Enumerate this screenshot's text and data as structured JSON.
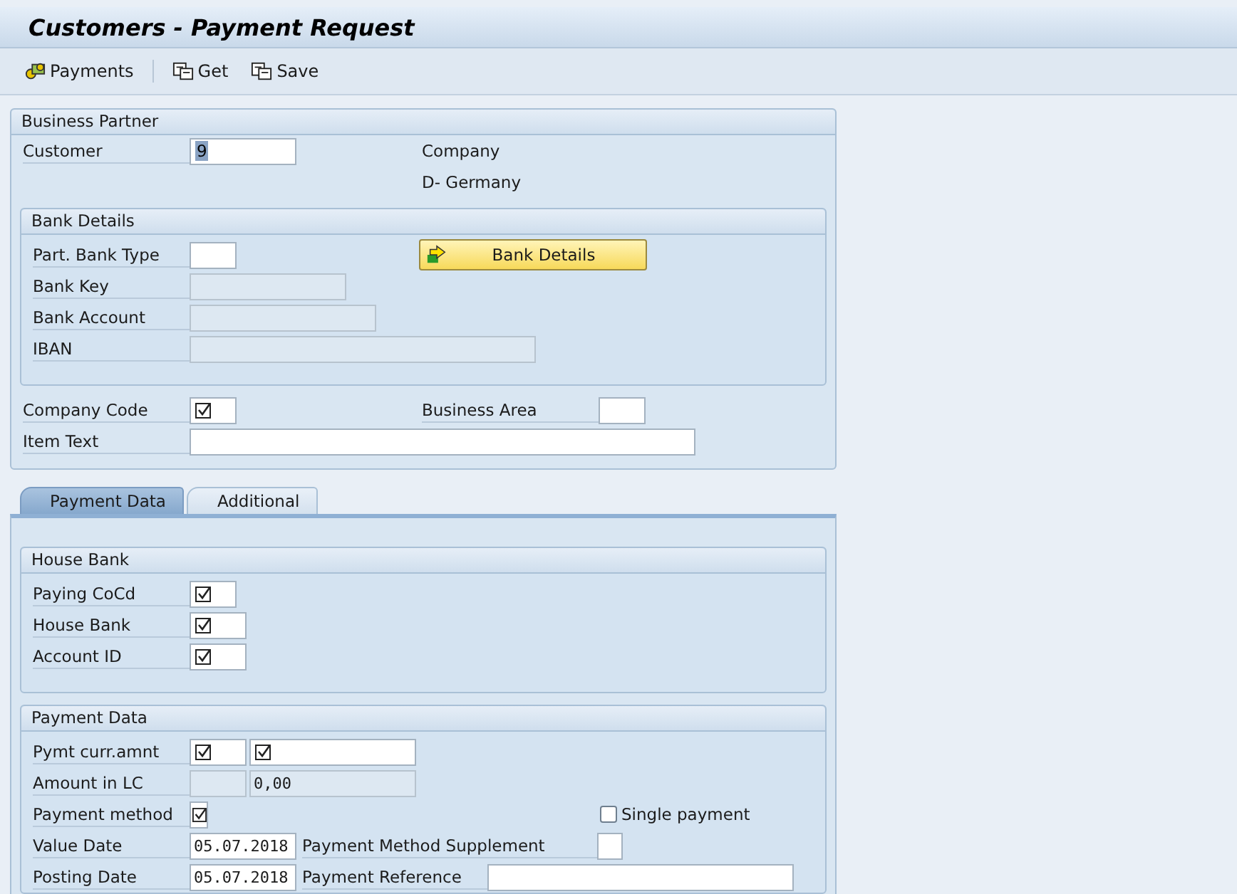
{
  "window": {
    "title": "Customers - Payment Request"
  },
  "toolbar": [
    {
      "label": "Payments",
      "kind": "payments"
    },
    {
      "label": "Get",
      "kind": "copy"
    },
    {
      "label": "Save",
      "kind": "copy"
    }
  ],
  "business_partner": {
    "title": "Business Partner",
    "customer": {
      "label": "Customer",
      "value": "9"
    },
    "company": "Company",
    "country": "D- Germany"
  },
  "bank_details": {
    "title": "Bank Details",
    "button": "Bank Details",
    "fields": [
      {
        "label": "Part. Bank Type",
        "kind": "input"
      },
      {
        "label": "Bank Key",
        "kind": "readonly"
      },
      {
        "label": "Bank Account",
        "kind": "readonly"
      },
      {
        "label": "IBAN",
        "kind": "readonly"
      }
    ]
  },
  "company_code": {
    "label": "Company Code",
    "required": true
  },
  "business_area": {
    "label": "Business Area",
    "required": false
  },
  "item_text": {
    "label": "Item Text",
    "required": false
  },
  "tabs": [
    {
      "label": "Payment Data",
      "selected": true
    },
    {
      "label": "Additional",
      "selected": false
    }
  ],
  "house_bank": {
    "title": "House Bank",
    "fields": [
      {
        "label": "Paying CoCd",
        "required": true
      },
      {
        "label": "House Bank",
        "required": true
      },
      {
        "label": "Account ID",
        "required": true
      }
    ]
  },
  "payment_data": {
    "title": "Payment Data",
    "payment_amount": {
      "label": "Pymt curr.amnt",
      "currency_required": true,
      "amount_required": true
    },
    "local_amount": {
      "label": "Amount in LC",
      "value": "0,00"
    },
    "payment_method": {
      "label": "Payment method",
      "required": true
    },
    "single_payment": {
      "label": "Single payment",
      "checked": false
    },
    "value_date": {
      "label": "Value Date",
      "value": "05.07.2018"
    },
    "supplement": {
      "label": "Payment Method Supplement"
    },
    "posting_date": {
      "label": "Posting Date",
      "value": "05.07.2018"
    },
    "reference": {
      "label": "Payment Reference"
    }
  }
}
